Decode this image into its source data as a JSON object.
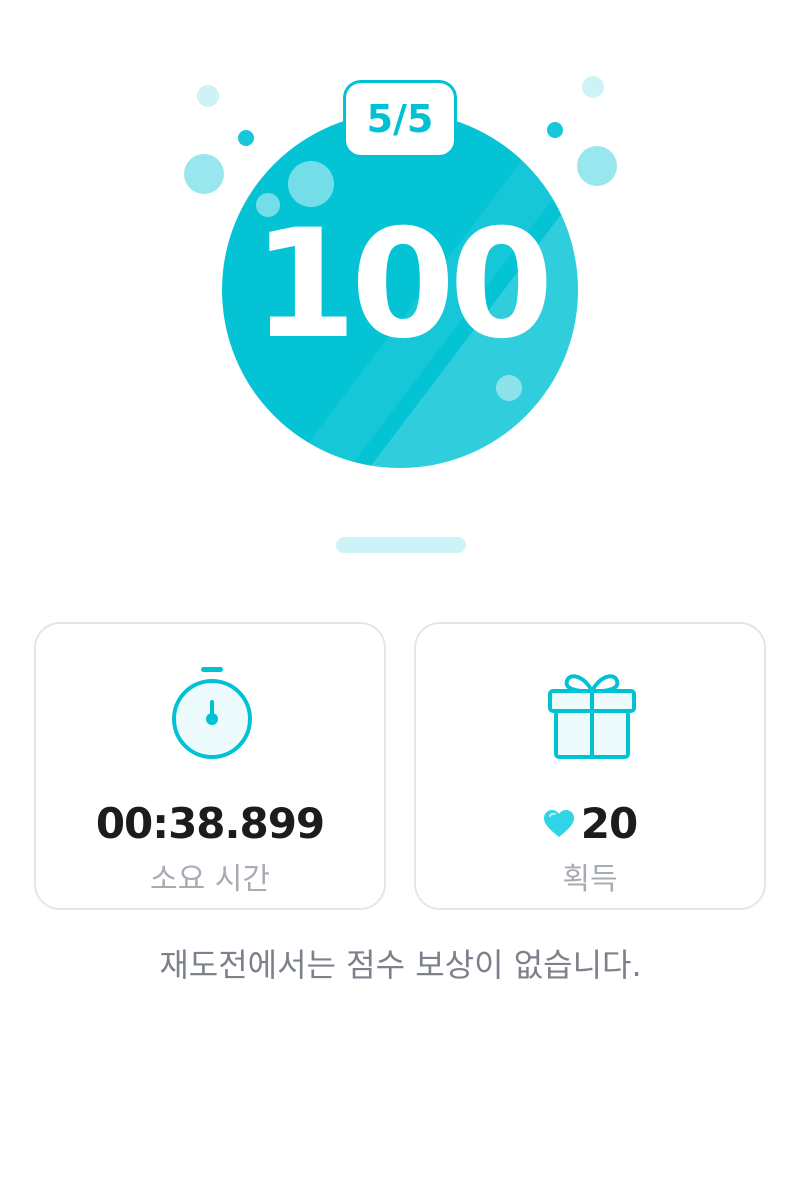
{
  "result": {
    "score": "100",
    "progress": "5/5"
  },
  "cards": {
    "time": {
      "value": "00:38.899",
      "label": "소요 시간",
      "icon": "stopwatch-icon"
    },
    "reward": {
      "value": "20",
      "label": "획득",
      "icon": "gift-icon",
      "value_icon": "heart-icon"
    }
  },
  "note": "재도전에서는 점수 보상이 없습니다.",
  "colors": {
    "accent": "#00c2d4",
    "accent_light": "#98e6ee",
    "text_dark": "#1c1c1e",
    "text_muted": "#a7abb3",
    "card_border": "#e3e6eb"
  }
}
